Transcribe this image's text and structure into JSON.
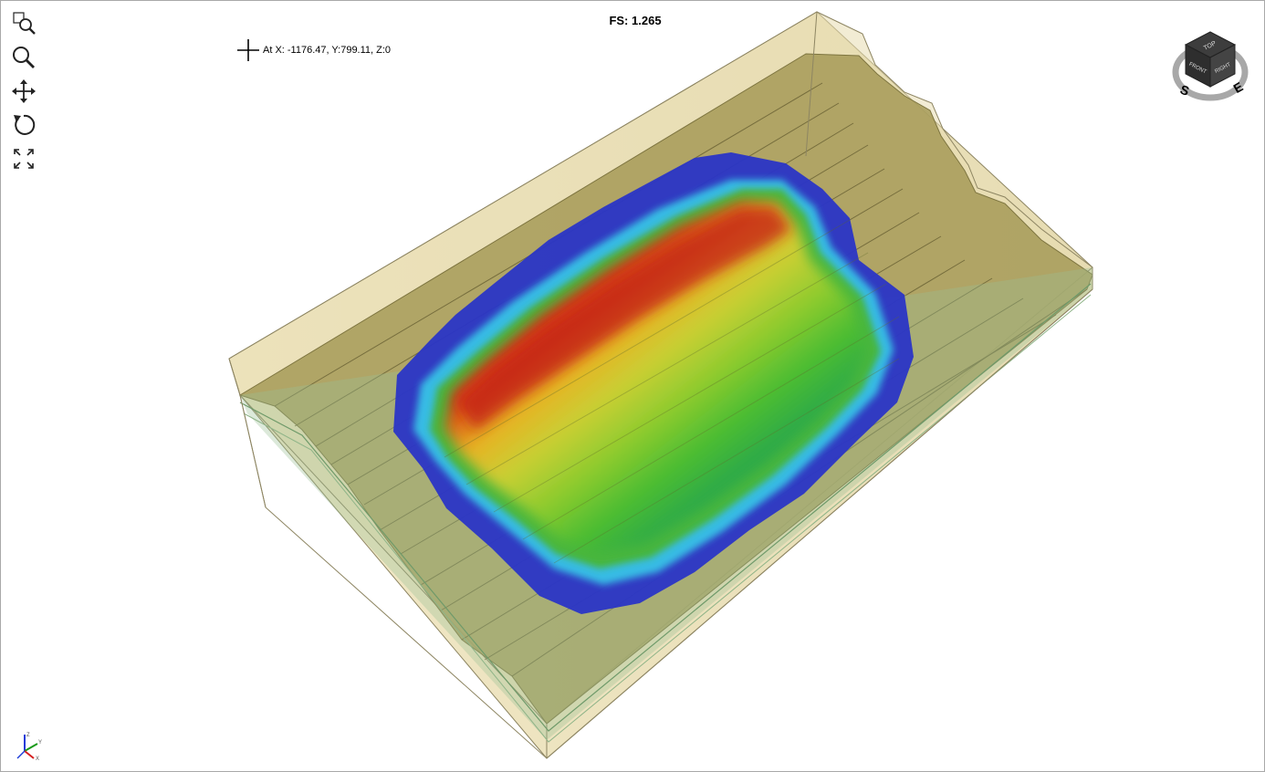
{
  "result": {
    "fs_prefix": "FS:",
    "fs_value": "1.265"
  },
  "cursor": {
    "readout": "At X: -1176.47, Y:799.11, Z:0"
  },
  "toolbar": {
    "items": [
      {
        "name": "zoom-window",
        "icon": "zoom-window-icon"
      },
      {
        "name": "zoom",
        "icon": "magnifier-icon"
      },
      {
        "name": "pan",
        "icon": "move-arrows-icon"
      },
      {
        "name": "rotate",
        "icon": "rotate-icon"
      },
      {
        "name": "zoom-all",
        "icon": "fit-extents-icon"
      }
    ]
  },
  "view_cube": {
    "top": "TOP",
    "front": "FRONT",
    "right": "RIGHT",
    "compass_s": "S",
    "compass_e": "E"
  },
  "axis_triad": {
    "z": "Z",
    "y": "Y",
    "x": "X",
    "colors": {
      "x": "#d62020",
      "y": "#1a9a1a",
      "z": "#1a3ad8"
    }
  },
  "colors": {
    "soil_fill": "#b9ab6a",
    "soil_top": "#9a9150",
    "bedrock_layer": "#9bbf94",
    "box_outline": "#8d8562",
    "contour_max": "#c81e1e",
    "contour_min": "#2531c8"
  }
}
